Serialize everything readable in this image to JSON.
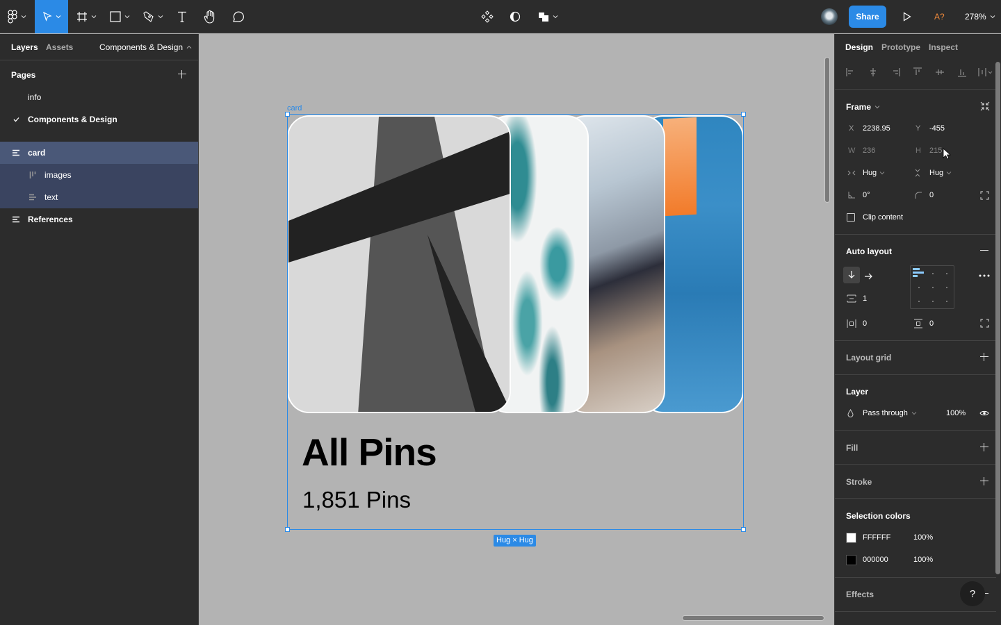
{
  "toolbar": {
    "tools": [
      "main-menu",
      "move",
      "frame",
      "shape",
      "pen",
      "text",
      "hand",
      "comment"
    ],
    "active_tool": "move",
    "share_label": "Share",
    "zoom_level": "278%",
    "font_warning": "A?",
    "accent_color": "#2B8AE6"
  },
  "left_panel": {
    "tabs": [
      "Layers",
      "Assets"
    ],
    "page_dropdown": "Components & Design",
    "pages_title": "Pages",
    "pages": [
      {
        "label": "info",
        "current": false
      },
      {
        "label": "Components & Design",
        "current": true
      }
    ],
    "layers": [
      {
        "label": "card",
        "selected": true,
        "icon": "vertical-auto-layout-icon"
      },
      {
        "label": "images",
        "child": true,
        "icon": "horizontal-auto-layout-icon"
      },
      {
        "label": "text",
        "child": true,
        "icon": "vertical-auto-layout-icon"
      },
      {
        "label": "References",
        "icon": "vertical-auto-layout-icon"
      }
    ]
  },
  "canvas": {
    "frame_label": "card",
    "card_title": "All Pins",
    "card_subtitle": "1,851 Pins",
    "size_badge": "Hug × Hug",
    "images": [
      "abstract-grayscale-shapes",
      "ocean-foam",
      "marbled-paint-swirl",
      "blue-orange-painting"
    ]
  },
  "right_panel": {
    "tabs": [
      "Design",
      "Prototype",
      "Inspect"
    ],
    "active_tab": "Design",
    "frame": {
      "title": "Frame",
      "x_label": "X",
      "x": "2238.95",
      "y_label": "Y",
      "y": "-455",
      "w_label": "W",
      "w": "236",
      "h_label": "H",
      "h": "215",
      "h_sizing": "Hug",
      "v_sizing": "Hug",
      "rotation": "0°",
      "corner_radius": "0",
      "clip_content": "Clip content",
      "clip_checked": false
    },
    "auto_layout": {
      "title": "Auto layout",
      "direction": "vertical",
      "spacing": "1",
      "h_padding": "0",
      "v_padding": "0"
    },
    "layout_grid": {
      "title": "Layout grid"
    },
    "layer": {
      "title": "Layer",
      "blend": "Pass through",
      "opacity": "100%"
    },
    "fill": {
      "title": "Fill"
    },
    "stroke": {
      "title": "Stroke"
    },
    "selection_colors": {
      "title": "Selection colors",
      "colors": [
        {
          "hex": "FFFFFF",
          "opacity": "100%",
          "swatch": "#FFFFFF"
        },
        {
          "hex": "000000",
          "opacity": "100%",
          "swatch": "#000000"
        }
      ]
    },
    "effects": {
      "title": "Effects"
    },
    "help_label": "?"
  }
}
